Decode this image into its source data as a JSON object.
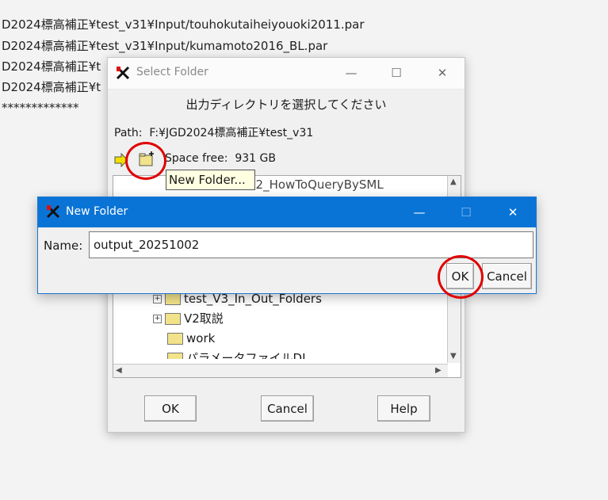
{
  "console": {
    "lines": [
      "D2024標高補正¥test_v31¥Input/touhokutaiheiyouoki2011.par",
      "D2024標高補正¥test_v31¥Input/kumamoto2016_BL.par",
      "D2024標高補正¥t",
      "D2024標高補正¥t",
      "*************"
    ]
  },
  "select_folder": {
    "title": "Select Folder",
    "heading": "出力ディレクトリを選択してください",
    "path_label": "Path:",
    "path_value": "F:¥JGD2024標高補正¥test_v31",
    "space_label": "Space free:",
    "space_value": "931 GB",
    "tooltip": "New Folder...",
    "tree_items": [
      {
        "label": "12_HowToQueryBySML",
        "expandable": false
      },
      {
        "label": "test_V3_In_Out_Folders",
        "expandable": true
      },
      {
        "label": "V2取説",
        "expandable": true
      },
      {
        "label": "work",
        "expandable": false
      },
      {
        "label": "パラメータファイルDL",
        "expandable": false
      }
    ],
    "buttons": {
      "ok": "OK",
      "cancel": "Cancel",
      "help": "Help"
    },
    "window_controls": {
      "minimize": "—",
      "maximize": "☐",
      "close": "✕"
    }
  },
  "new_folder": {
    "title": "New Folder",
    "name_label": "Name:",
    "name_value": "output_20251002",
    "buttons": {
      "ok": "OK",
      "cancel": "Cancel"
    },
    "window_controls": {
      "minimize": "—",
      "maximize": "☐",
      "close": "✕"
    }
  },
  "colors": {
    "accent": "#0a74d6",
    "highlight_circle": "#e00000",
    "folder": "#f2e38a"
  }
}
